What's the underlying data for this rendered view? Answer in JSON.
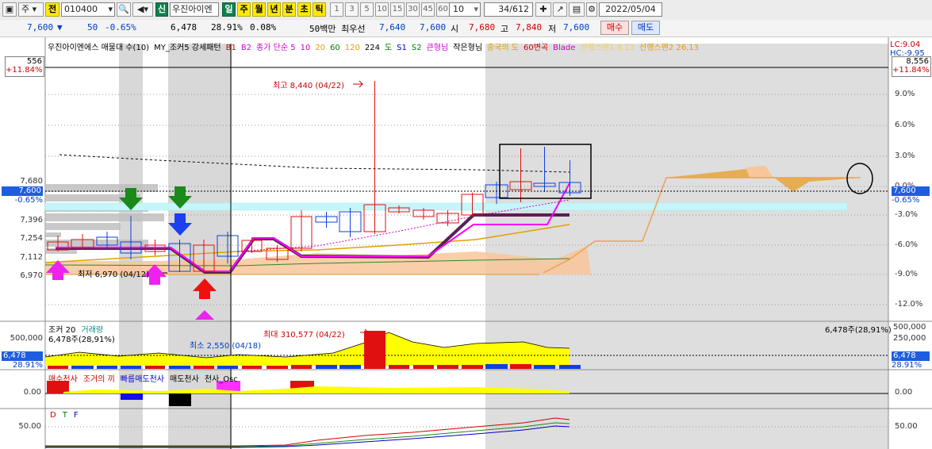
{
  "toolbar": {
    "market_label": "주",
    "market_btn": "전",
    "code": "010400",
    "new_badge": "신",
    "stock_name": "우진아이엔",
    "periods": [
      "일",
      "주",
      "월",
      "년",
      "분",
      "초",
      "틱"
    ],
    "minutes": [
      "1",
      "3",
      "5",
      "10",
      "15",
      "30",
      "45",
      "60"
    ],
    "count": "10",
    "page": "34/612",
    "date": "2022/05/04"
  },
  "quote": {
    "price": "7,600",
    "change": "50",
    "change_pct": "-0.65%",
    "volume": "6,478",
    "vol_ratio": "28.91%",
    "turnover": "0.08%",
    "tag": "50백만 최우선",
    "ask": "7,640",
    "bid": "7,600",
    "open_label": "시",
    "open": "7,680",
    "high_label": "고",
    "high": "7,840",
    "low_label": "저",
    "low": "7,600",
    "buy_btn": "매수",
    "sell_btn": "매도"
  },
  "legend_main": [
    {
      "text": "우진아이엔에스 매물대 수(10)",
      "color": "#000000"
    },
    {
      "text": "MY_조커5 강세패턴",
      "color": "#000000"
    },
    {
      "text": "B1",
      "color": "#d00000"
    },
    {
      "text": "B2",
      "color": "#d000d0"
    },
    {
      "text": "종가 단순 5",
      "color": "#d000d0"
    },
    {
      "text": "10",
      "color": "#d000d0"
    },
    {
      "text": "20",
      "color": "#e0a000"
    },
    {
      "text": "60",
      "color": "#008000"
    },
    {
      "text": "120",
      "color": "#e0a000"
    },
    {
      "text": "224",
      "color": "#000000"
    },
    {
      "text": "도",
      "color": "#008000"
    },
    {
      "text": "S1",
      "color": "#0000d0"
    },
    {
      "text": "S2",
      "color": "#008000"
    },
    {
      "text": "큰형님",
      "color": "#d000d0"
    },
    {
      "text": "작은형님",
      "color": "#000000"
    },
    {
      "text": "중국의 도",
      "color": "#e0a000"
    },
    {
      "text": "60변곡",
      "color": "#d00000"
    },
    {
      "text": "Blade",
      "color": "#d000d0"
    },
    {
      "text": "선행스팬1 8,13",
      "color": "#f0d060"
    },
    {
      "text": "선행스팬2 26,13",
      "color": "#e0a000"
    }
  ],
  "lc_hc": {
    "lc": "LC:9.04",
    "hc": "HC:-9.95"
  },
  "left_box": {
    "top": "556",
    "pct": "+11.84%"
  },
  "right_box": {
    "top": "8,556",
    "pct": "+11.84%"
  },
  "price_left_ticks": [
    "7,680",
    "7,396",
    "7,254",
    "7,112",
    "6,970"
  ],
  "price_left_current": {
    "value": "7,600",
    "pct": "-0.65%"
  },
  "price_right_ticks": [
    "9.0%",
    "6.0%",
    "3.0%",
    "0.0%",
    "-3.0%",
    "-6.0%",
    "-9.0%",
    "-12.0%"
  ],
  "price_right_current": {
    "value": "7,600",
    "pct": "-0.65%"
  },
  "annot_high": "최고 8,440 (04/22)",
  "annot_low": "최저 6,970 (04/12)",
  "vol_panel": {
    "legend_a": "조커 20",
    "legend_b": "거래량",
    "sub": "6,478주(28,91%)",
    "right_label": "6,478주(28,91%)",
    "max_label": "최대 310,577 (04/22)",
    "min_label": "최소 2,550 (04/18)",
    "left_tick": "500,000",
    "left_current": {
      "value": "6,478",
      "pct": "28.91%"
    },
    "right_ticks": [
      "500,000",
      "250,000"
    ],
    "right_current": {
      "value": "6,478",
      "pct": "28.91%"
    }
  },
  "osc_panel": {
    "legend": [
      {
        "text": "매수천사",
        "color": "#d00000"
      },
      {
        "text": "조거의 끼",
        "color": "#d00000"
      },
      {
        "text": "빠름매도천사",
        "color": "#0000d0"
      },
      {
        "text": "매도천사",
        "color": "#000000"
      },
      {
        "text": "천사_Osc",
        "color": "#000000"
      }
    ],
    "left_tick": "0.00",
    "right_tick": "0.00"
  },
  "dtf_panel": {
    "legend": [
      {
        "text": "D",
        "color": "#d00000"
      },
      {
        "text": "T",
        "color": "#008000"
      },
      {
        "text": "F",
        "color": "#0000d0"
      }
    ],
    "left_tick": "50.00",
    "right_tick": "50.00"
  }
}
